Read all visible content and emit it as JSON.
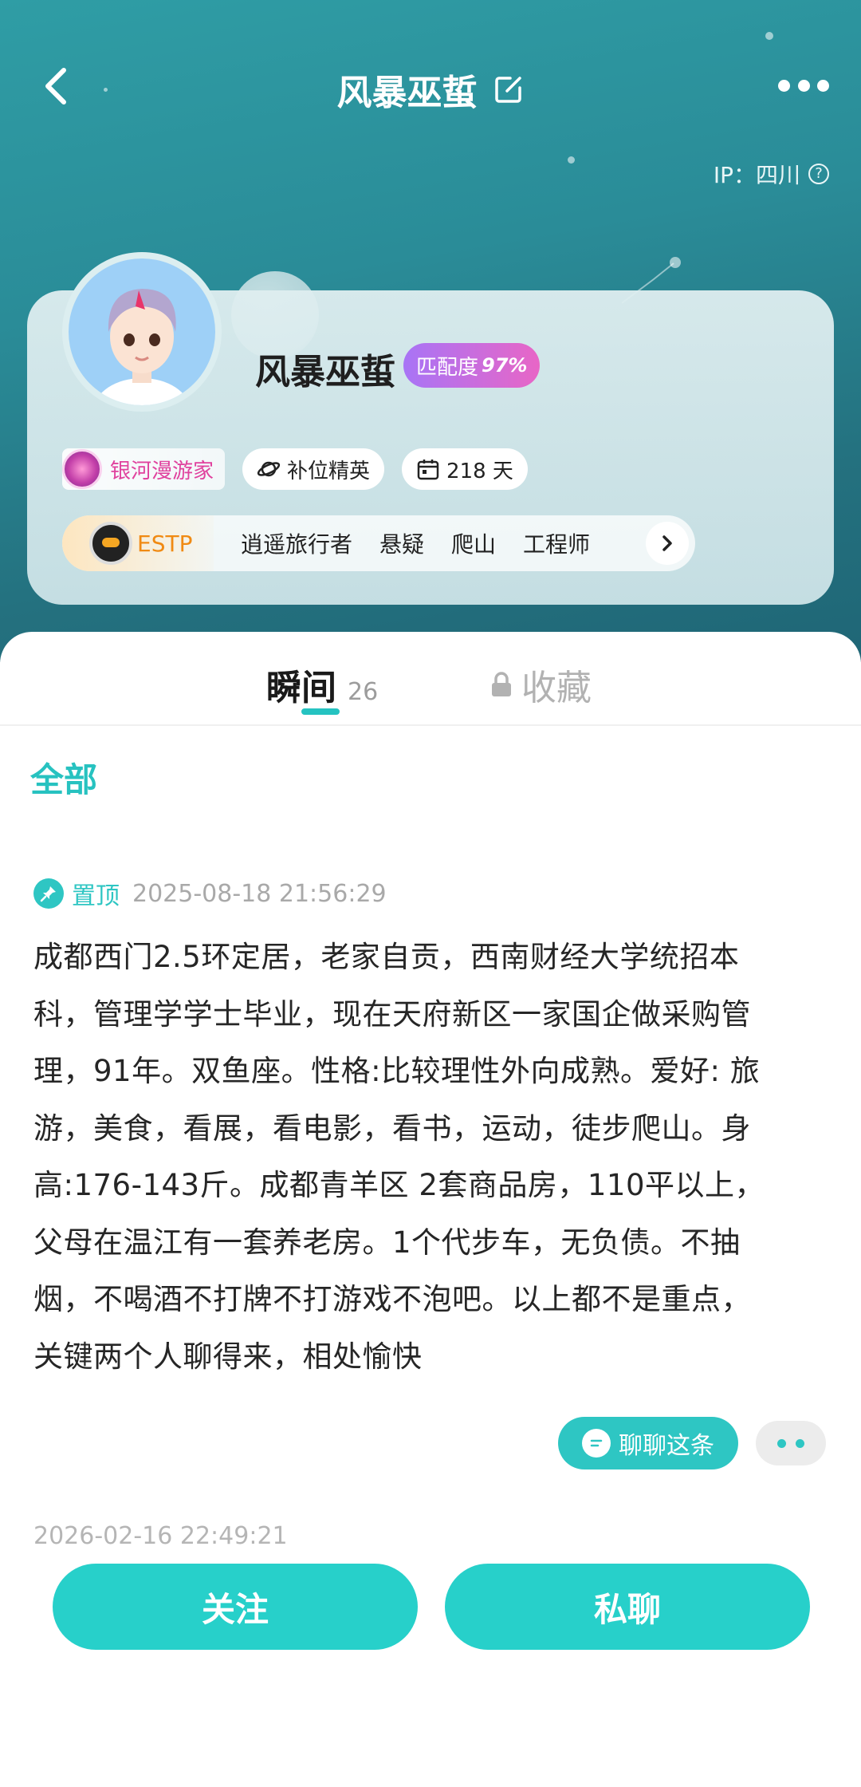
{
  "header": {
    "title": "风暴巫蜇",
    "ip_label": "IP：四川"
  },
  "profile": {
    "nickname": "风暴巫蜇",
    "match_label": "匹配度",
    "match_value": "97%",
    "level_tag": "银河漫游家",
    "badge_label": "补位精英",
    "days_label": "218 天",
    "mbti": "ESTP",
    "interests": [
      "逍遥旅行者",
      "悬疑",
      "爬山",
      "工程师"
    ]
  },
  "tabs": {
    "moments_label": "瞬间",
    "moments_count": "26",
    "favorites_label": "收藏"
  },
  "filter": {
    "all_label": "全部"
  },
  "post": {
    "pinned_label": "置顶",
    "time": "2025-08-18 21:56:29",
    "lines": [
      "成都西门2.5环定居，老家自贡，西南财经大学统招本",
      "科，管理学学士毕业，现在天府新区一家国企做采购管",
      "理，91年。双鱼座。性格:比较理性外向成熟。爱好: 旅",
      "游，美食，看展，看电影，看书，运动，徒步爬山。身",
      "高:176-143斤。成都青羊区 2套商品房，110平以上，",
      "父母在温江有一套养老房。1个代步车，无负债。不抽",
      "烟，不喝酒不打牌不打游戏不泡吧。以上都不是重点，",
      "关键两个人聊得来，相处愉快"
    ],
    "chat_button": "聊聊这条"
  },
  "next_post": {
    "time": "2026-02-16 22:49:21"
  },
  "actions": {
    "follow": "关注",
    "private_chat": "私聊"
  },
  "colors": {
    "accent": "#27d0ca",
    "header_bg": "#2a8c98",
    "level_pink": "#e0429e",
    "mbti_orange": "#f08a13"
  }
}
